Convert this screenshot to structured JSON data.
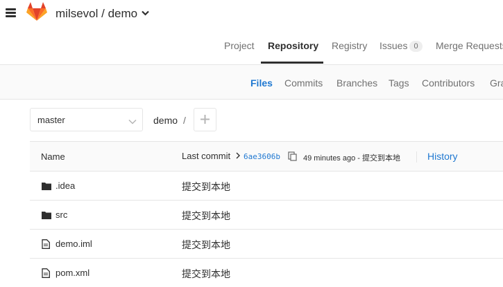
{
  "header": {
    "project_title": "milsevol / demo",
    "colors": {
      "gitlab_orange": "#fc6d26",
      "gitlab_red": "#e24329",
      "gitlab_yellow": "#fca326"
    }
  },
  "project_nav": {
    "items": [
      {
        "label": "Project",
        "active": false
      },
      {
        "label": "Repository",
        "active": true
      },
      {
        "label": "Registry",
        "active": false
      },
      {
        "label": "Issues",
        "badge": "0",
        "active": false
      },
      {
        "label": "Merge Requests",
        "active": false
      }
    ]
  },
  "sub_nav": {
    "items": [
      {
        "label": "Files",
        "active": true
      },
      {
        "label": "Commits",
        "active": false
      },
      {
        "label": "Branches",
        "active": false
      },
      {
        "label": "Tags",
        "active": false
      },
      {
        "label": "Contributors",
        "active": false
      },
      {
        "label": "Gra",
        "active": false
      }
    ],
    "accent_color": "#1f78d1"
  },
  "branch_bar": {
    "branch": "master",
    "breadcrumb": "demo",
    "separator": "/"
  },
  "table": {
    "header_name": "Name",
    "last_commit_label": "Last commit",
    "commit_sha": "6ae3606b",
    "commit_meta": "49 minutes ago - 提交到本地",
    "history_label": "History",
    "rows": [
      {
        "type": "folder",
        "icon": "folder-icon",
        "name": ".idea",
        "message": "提交到本地"
      },
      {
        "type": "folder",
        "icon": "folder-icon",
        "name": "src",
        "message": "提交到本地"
      },
      {
        "type": "file",
        "icon": "file-icon",
        "name": "demo.iml",
        "message": "提交到本地"
      },
      {
        "type": "file",
        "icon": "file-icon",
        "name": "pom.xml",
        "message": "提交到本地"
      }
    ]
  }
}
